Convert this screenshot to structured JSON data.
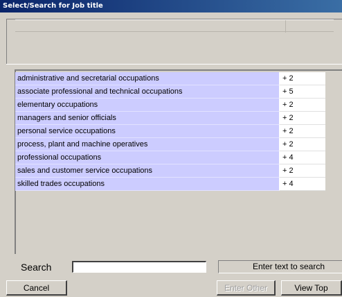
{
  "window": {
    "title": "Select/Search for Job title"
  },
  "occupations": [
    {
      "name": "administrative and secretarial occupations",
      "count": "+ 2"
    },
    {
      "name": "associate professional and technical occupations",
      "count": "+ 5"
    },
    {
      "name": "elementary occupations",
      "count": "+ 2"
    },
    {
      "name": "managers and senior officials",
      "count": "+ 2"
    },
    {
      "name": "personal service occupations",
      "count": "+ 2"
    },
    {
      "name": "process, plant and machine operatives",
      "count": "+ 2"
    },
    {
      "name": "professional occupations",
      "count": "+ 4"
    },
    {
      "name": "sales and customer service occupations",
      "count": "+ 2"
    },
    {
      "name": "skilled trades occupations",
      "count": "+ 4"
    }
  ],
  "search": {
    "label": "Search",
    "value": "",
    "hint": "Enter text to search"
  },
  "buttons": {
    "cancel": "Cancel",
    "enter_other": "Enter Other",
    "view_top": "View Top"
  },
  "colors": {
    "title_bar": "#0a246a",
    "row_highlight": "#ccccff",
    "window_background": "#d4d0c8"
  }
}
